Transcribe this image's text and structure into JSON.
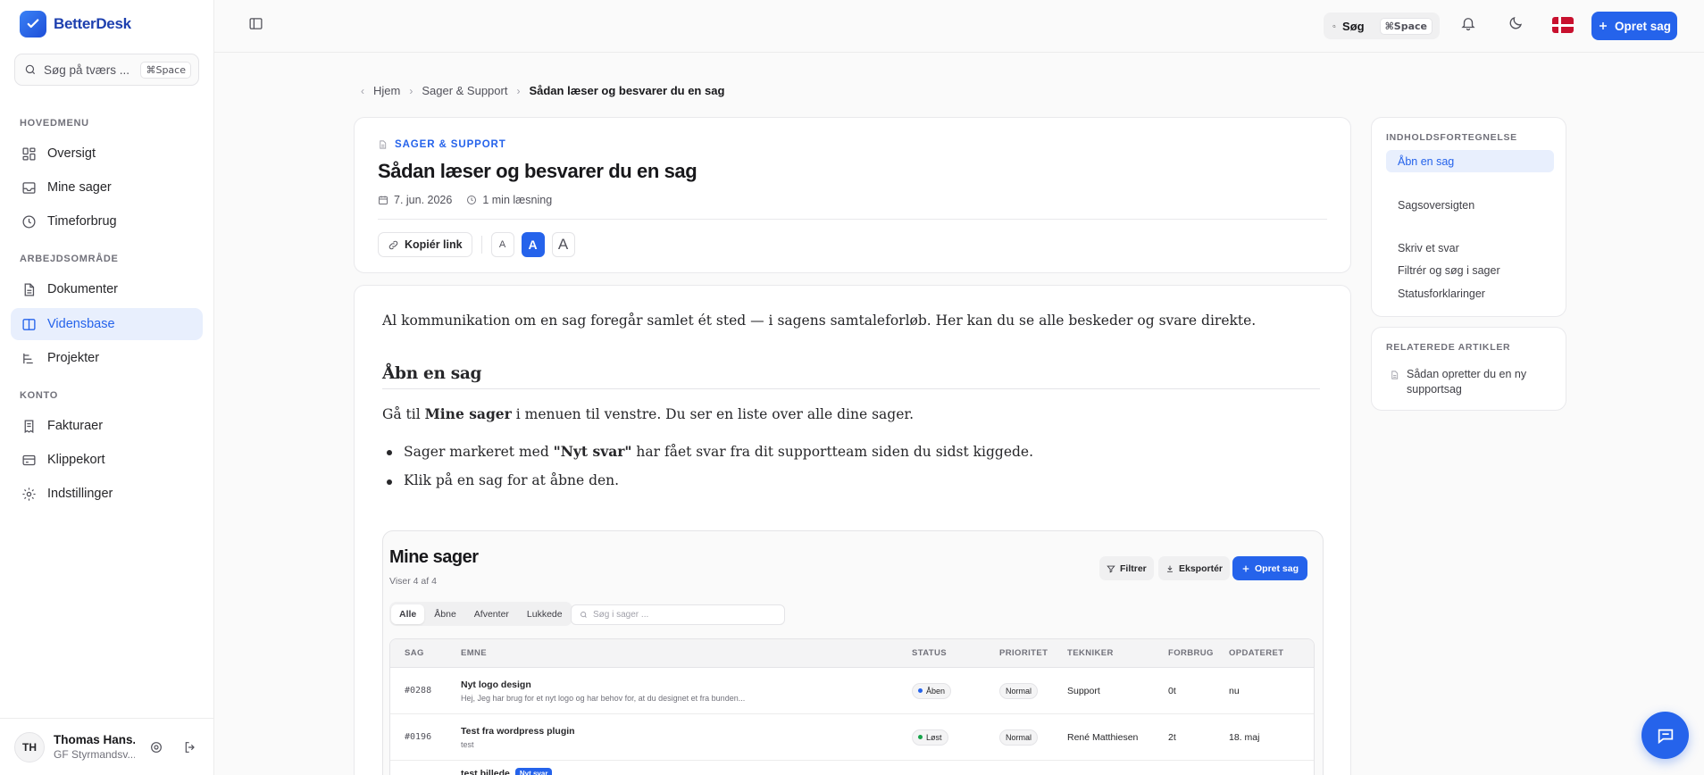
{
  "app": {
    "name": "BetterDesk"
  },
  "sidebar": {
    "search": {
      "placeholder": "Søg på tværs ...",
      "shortcut": "⌘Space"
    },
    "sections": [
      {
        "label": "HOVEDMENU"
      },
      {
        "label": "ARBEJDSOMRÅDE"
      },
      {
        "label": "KONTO"
      }
    ],
    "items": [
      {
        "label": "Oversigt",
        "icon": "dashboard-icon"
      },
      {
        "label": "Mine sager",
        "icon": "inbox-icon"
      },
      {
        "label": "Timeforbrug",
        "icon": "clock-icon"
      },
      {
        "label": "Dokumenter",
        "icon": "document-icon"
      },
      {
        "label": "Vidensbase",
        "icon": "book-icon",
        "active": true
      },
      {
        "label": "Projekter",
        "icon": "projects-icon"
      },
      {
        "label": "Fakturaer",
        "icon": "invoice-icon"
      },
      {
        "label": "Klippekort",
        "icon": "card-icon"
      },
      {
        "label": "Indstillinger",
        "icon": "gear-icon"
      }
    ],
    "user": {
      "initials": "TH",
      "name": "Thomas Hans...",
      "org": "GF Styrmandsv..."
    }
  },
  "topbar": {
    "search_label": "Søg",
    "search_shortcut": "⌘Space",
    "create_label": "Opret sag",
    "accent": "#2563eb"
  },
  "breadcrumb": {
    "home": "Hjem",
    "section": "Sager & Support",
    "current": "Sådan læser og besvarer du en sag"
  },
  "article": {
    "category": "SAGER & SUPPORT",
    "title": "Sådan læser og besvarer du en sag",
    "date": "7. jun. 2026",
    "read_time": "1 min læsning",
    "copy_link": "Kopiér link",
    "font_sizes": [
      "A",
      "A",
      "A"
    ],
    "intro": "Al kommunikation om en sag foregår samlet ét sted — i sagens samtaleforløb. Her kan du se alle beskeder og svare direkte.",
    "h2": "Åbn en sag",
    "p2_pre": "Gå til ",
    "p2_bold": "Mine sager",
    "p2_post": " i menuen til venstre. Du ser en liste over alle dine sager.",
    "bullet1_pre": "Sager markeret med ",
    "bullet1_bold": "\"Nyt svar\"",
    "bullet1_post": " har fået svar fra dit supportteam siden du sidst kiggede.",
    "bullet2": "Klik på en sag for at åbne den."
  },
  "embedded": {
    "title": "Mine sager",
    "subtitle": "Viser 4 af 4",
    "filter": "Filtrer",
    "export": "Eksportér",
    "create": "Opret sag",
    "tabs": [
      "Alle",
      "Åbne",
      "Afventer",
      "Lukkede"
    ],
    "search_placeholder": "Søg i sager ...",
    "columns": [
      "SAG",
      "EMNE",
      "STATUS",
      "PRIORITET",
      "TEKNIKER",
      "FORBRUG",
      "OPDATERET"
    ],
    "rows": [
      {
        "id": "#0288",
        "subject": "Nyt logo design",
        "sub": "Hej, Jeg har brug for et nyt logo og har behov for, at du designet et fra bunden...",
        "status": "Åben",
        "status_color": "#2563eb",
        "priority": "Normal",
        "tech": "Support",
        "usage": "0t",
        "updated": "nu"
      },
      {
        "id": "#0196",
        "subject": "Test fra wordpress plugin",
        "sub": "test",
        "status": "Løst",
        "status_color": "#16a34a",
        "priority": "Normal",
        "tech": "René Matthiesen",
        "usage": "2t",
        "updated": "18. maj"
      },
      {
        "id": "",
        "subject": "test billede",
        "sub": "",
        "new_tag": "Nyt svar",
        "status": "",
        "priority": "",
        "tech": "",
        "usage": "",
        "updated": ""
      }
    ]
  },
  "toc": {
    "label": "INDHOLDSFORTEGNELSE",
    "items": [
      "Åbn en sag",
      "Sagsoversigten",
      "Skriv et svar",
      "Filtrér og søg i sager",
      "Statusforklaringer"
    ]
  },
  "related": {
    "label": "RELATEREDE ARTIKLER",
    "items": [
      "Sådan opretter du en ny supportsag"
    ]
  }
}
